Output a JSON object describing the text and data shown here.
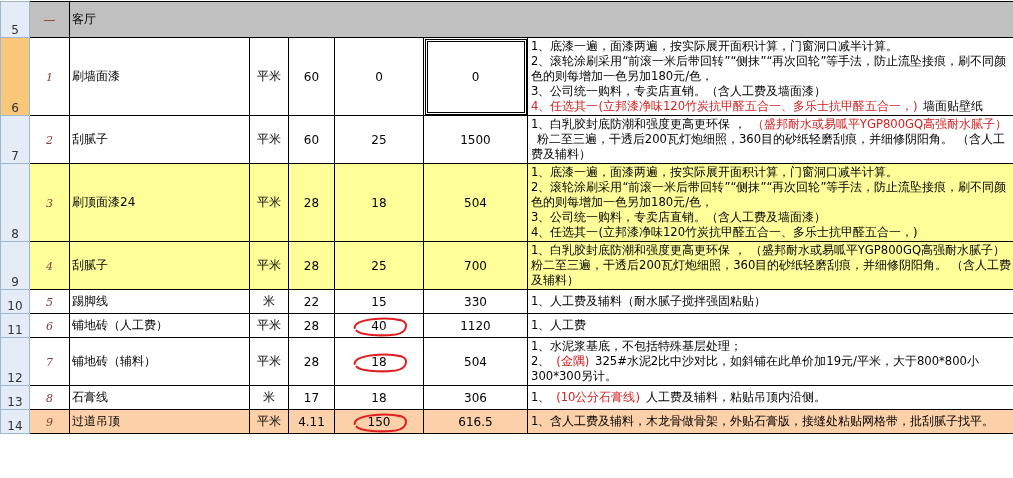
{
  "section": {
    "row_number": "5",
    "marker": "—",
    "title": "客厅"
  },
  "rows": [
    {
      "row_number": "6",
      "selected": true,
      "color": "#ffffff",
      "index": "1",
      "name": "刷墙面漆",
      "unit": "平米",
      "quantity": "60",
      "unit_price": "0",
      "price_circled": false,
      "total": "0",
      "description": [
        [
          {
            "text": "1、底漆一遍，面漆两遍，按实际展开面积计算，门窗洞口减半计算。",
            "emphasis": false
          }
        ],
        [
          {
            "text": "2、滚轮涂刷采用“前滚一米后带回转”“侧抹”“再次回轮”等手法，防止流坠接痕，刷不同颜色的则每增加一色另加180元/色，",
            "emphasis": false
          }
        ],
        [
          {
            "text": "3、公司统一购料，专卖店直销。（含人工费及墙面漆）",
            "emphasis": false
          }
        ],
        [
          {
            "text": "4、任选其一(立邦漆净味120竹炭抗甲醛五合一、多乐士抗甲醛五合一，)",
            "emphasis": true
          },
          {
            "text": "墙面贴壁纸",
            "emphasis": false
          }
        ]
      ]
    },
    {
      "row_number": "7",
      "selected": false,
      "color": "#ffffff",
      "index": "2",
      "name": "刮腻子",
      "unit": "平米",
      "quantity": "60",
      "unit_price": "25",
      "price_circled": false,
      "total": "1500",
      "description": [
        [
          {
            "text": "1、白乳胶封底防潮和强度更高更环保 ，",
            "emphasis": false
          },
          {
            "text": "（盛邦耐水或易呱平YGP800GQ高强耐水腻子）",
            "emphasis": true
          },
          {
            "text": "粉二至三遍，干透后200瓦灯炮细照，360目的砂纸轻磨刮痕，并细修阴阳角。 （含人工费及辅料）",
            "emphasis": false
          }
        ]
      ]
    },
    {
      "row_number": "8",
      "selected": false,
      "color": "#ffff99",
      "index": "3",
      "name": "刷顶面漆24",
      "unit": "平米",
      "quantity": "28",
      "unit_price": "18",
      "price_circled": false,
      "total": "504",
      "description": [
        [
          {
            "text": "1、底漆一遍，面漆两遍，按实际展开面积计算，门窗洞口减半计算。",
            "emphasis": false
          }
        ],
        [
          {
            "text": "2、滚轮涂刷采用“前滚一米后带回转”“侧抹”“再次回轮”等手法，防止流坠接痕，刷不同颜色的则每增加一色另加180元/色，",
            "emphasis": false
          }
        ],
        [
          {
            "text": "3、公司统一购料，专卖店直销。（含人工费及墙面漆）",
            "emphasis": false
          }
        ],
        [
          {
            "text": "4、任选其一(立邦漆净味120竹炭抗甲醛五合一、多乐士抗甲醛五合一，)",
            "emphasis": false
          }
        ]
      ]
    },
    {
      "row_number": "9",
      "selected": false,
      "color": "#ffff99",
      "index": "4",
      "name": "刮腻子",
      "unit": "平米",
      "quantity": "28",
      "unit_price": "25",
      "price_circled": false,
      "total": "700",
      "description": [
        [
          {
            "text": "1、白乳胶封底防潮和强度更高更环保 ， （盛邦耐水或易呱平YGP800GQ高强耐水腻子）粉二至三遍，干透后200瓦灯炮细照，360目的砂纸轻磨刮痕，并细修阴阳角。 （含人工费及辅料）",
            "emphasis": false
          }
        ]
      ]
    },
    {
      "row_number": "10",
      "selected": false,
      "color": "#ffffff",
      "index": "5",
      "name": "踢脚线",
      "unit": "米",
      "quantity": "22",
      "unit_price": "15",
      "price_circled": false,
      "total": "330",
      "description": [
        [
          {
            "text": "1、人工费及辅料（耐水腻子搅拌强固粘贴）",
            "emphasis": false
          }
        ]
      ]
    },
    {
      "row_number": "11",
      "selected": false,
      "color": "#ffffff",
      "index": "6",
      "name": "铺地砖（人工费）",
      "unit": "平米",
      "quantity": "28",
      "unit_price": "40",
      "price_circled": true,
      "total": "1120",
      "description": [
        [
          {
            "text": "1、人工费",
            "emphasis": false
          }
        ]
      ]
    },
    {
      "row_number": "12",
      "selected": false,
      "color": "#ffffff",
      "index": "7",
      "name": "铺地砖（辅料）",
      "unit": "平米",
      "quantity": "28",
      "unit_price": "18",
      "price_circled": true,
      "total": "504",
      "description": [
        [
          {
            "text": "1、水泥浆基底，不包括特殊基层处理；",
            "emphasis": false
          }
        ],
        [
          {
            "text": "2、",
            "emphasis": false
          },
          {
            "text": "(金隅)",
            "emphasis": true
          },
          {
            "text": "325#水泥2比中沙对比，如斜铺在此单价加19元/平米，大于800*800小300*300另计。",
            "emphasis": false
          }
        ]
      ]
    },
    {
      "row_number": "13",
      "selected": false,
      "color": "#ffffff",
      "index": "8",
      "name": "石膏线",
      "unit": "米",
      "quantity": "17",
      "unit_price": "18",
      "price_circled": false,
      "total": "306",
      "description": [
        [
          {
            "text": "1、",
            "emphasis": false
          },
          {
            "text": "(10公分石膏线)",
            "emphasis": true
          },
          {
            "text": "人工费及辅料，粘贴吊顶内沿侧。",
            "emphasis": false
          }
        ]
      ]
    },
    {
      "row_number": "14",
      "selected": false,
      "color": "#fcd0a8",
      "index": "9",
      "name": "过道吊顶",
      "unit": "平米",
      "quantity": "4.11",
      "unit_price": "150",
      "price_circled": true,
      "total": "616.5",
      "description": [
        [
          {
            "text": "1、含人工费及辅料，木龙骨做骨架，外贴石膏版，接缝处粘贴网格带，批刮腻子找平。",
            "emphasis": false
          }
        ]
      ]
    }
  ]
}
